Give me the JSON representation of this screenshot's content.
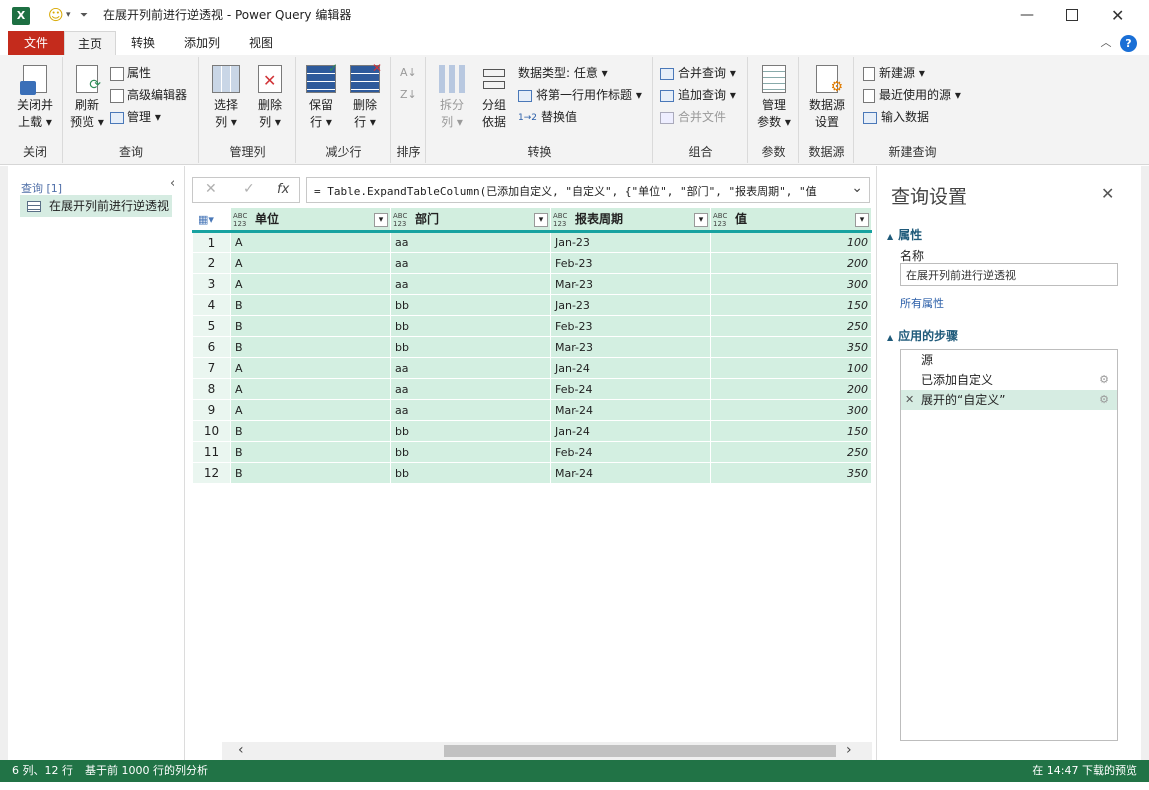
{
  "window": {
    "title": "在展开列前进行逆透视 - Power Query 编辑器",
    "min_icon": "minimize-icon",
    "max_icon": "maximize-icon",
    "close_icon": "close-icon"
  },
  "tabs": [
    "文件",
    "主页",
    "转换",
    "添加列",
    "视图"
  ],
  "ribbon": {
    "close": {
      "label1": "关闭并",
      "label2": "上载 ▾",
      "group": "关闭"
    },
    "query": {
      "refresh1": "刷新",
      "refresh2": "预览 ▾",
      "properties": "属性",
      "advanced_editor": "高级编辑器",
      "manage": "管理 ▾",
      "group": "查询"
    },
    "manage_cols": {
      "choose1": "选择",
      "choose2": "列 ▾",
      "remove1": "删除",
      "remove2": "列 ▾",
      "group": "管理列"
    },
    "reduce_rows": {
      "keep1": "保留",
      "keep2": "行 ▾",
      "remove1": "删除",
      "remove2": "行 ▾",
      "group": "减少行"
    },
    "sort": {
      "group": "排序"
    },
    "transform": {
      "split1": "拆分",
      "split2": "列 ▾",
      "groupby1": "分组",
      "groupby2": "依据",
      "datatype": "数据类型: 任意 ▾",
      "first_row": "将第一行用作标题 ▾",
      "replace": "替换值",
      "group": "转换"
    },
    "combine": {
      "merge": "合并查询 ▾",
      "append": "追加查询 ▾",
      "combine_files": "合并文件",
      "group": "组合"
    },
    "params": {
      "manage1": "管理",
      "manage2": "参数 ▾",
      "group": "参数"
    },
    "datasource": {
      "settings1": "数据源",
      "settings2": "设置",
      "group": "数据源"
    },
    "new_query": {
      "new_source": "新建源 ▾",
      "recent": "最近使用的源 ▾",
      "enter": "输入数据",
      "group": "新建查询"
    }
  },
  "left_pane": {
    "header": "查询 [1]",
    "item": "在展开列前进行逆透视"
  },
  "formula": {
    "fx": "fx",
    "text": "= Table.ExpandTableColumn(已添加自定义, \"自定义\", {\"单位\", \"部门\", \"报表周期\", \"值"
  },
  "grid": {
    "columns": [
      {
        "type": "ABC\n123",
        "name": "单位"
      },
      {
        "type": "ABC\n123",
        "name": "部门"
      },
      {
        "type": "ABC\n123",
        "name": "报表周期"
      },
      {
        "type": "ABC\n123",
        "name": "值"
      }
    ],
    "rows": [
      [
        "1",
        "A",
        "aa",
        "Jan-23",
        "100"
      ],
      [
        "2",
        "A",
        "aa",
        "Feb-23",
        "200"
      ],
      [
        "3",
        "A",
        "aa",
        "Mar-23",
        "300"
      ],
      [
        "4",
        "B",
        "bb",
        "Jan-23",
        "150"
      ],
      [
        "5",
        "B",
        "bb",
        "Feb-23",
        "250"
      ],
      [
        "6",
        "B",
        "bb",
        "Mar-23",
        "350"
      ],
      [
        "7",
        "A",
        "aa",
        "Jan-24",
        "100"
      ],
      [
        "8",
        "A",
        "aa",
        "Feb-24",
        "200"
      ],
      [
        "9",
        "A",
        "aa",
        "Mar-24",
        "300"
      ],
      [
        "10",
        "B",
        "bb",
        "Jan-24",
        "150"
      ],
      [
        "11",
        "B",
        "bb",
        "Feb-24",
        "250"
      ],
      [
        "12",
        "B",
        "bb",
        "Mar-24",
        "350"
      ]
    ]
  },
  "settings": {
    "title": "查询设置",
    "properties": "属性",
    "name_label": "名称",
    "name_value": "在展开列前进行逆透视",
    "all_props": "所有属性",
    "steps_title": "应用的步骤",
    "steps": [
      "源",
      "已添加自定义",
      "展开的“自定义”"
    ]
  },
  "status": {
    "left1": "6 列、12 行",
    "left2": "基于前 1000 行的列分析",
    "right": "在 14:47 下载的预览"
  },
  "colors": {
    "accent": "#217346",
    "file_tab": "#c42b1c",
    "grid": "#d3efe1",
    "header_line": "#17a2a0"
  }
}
